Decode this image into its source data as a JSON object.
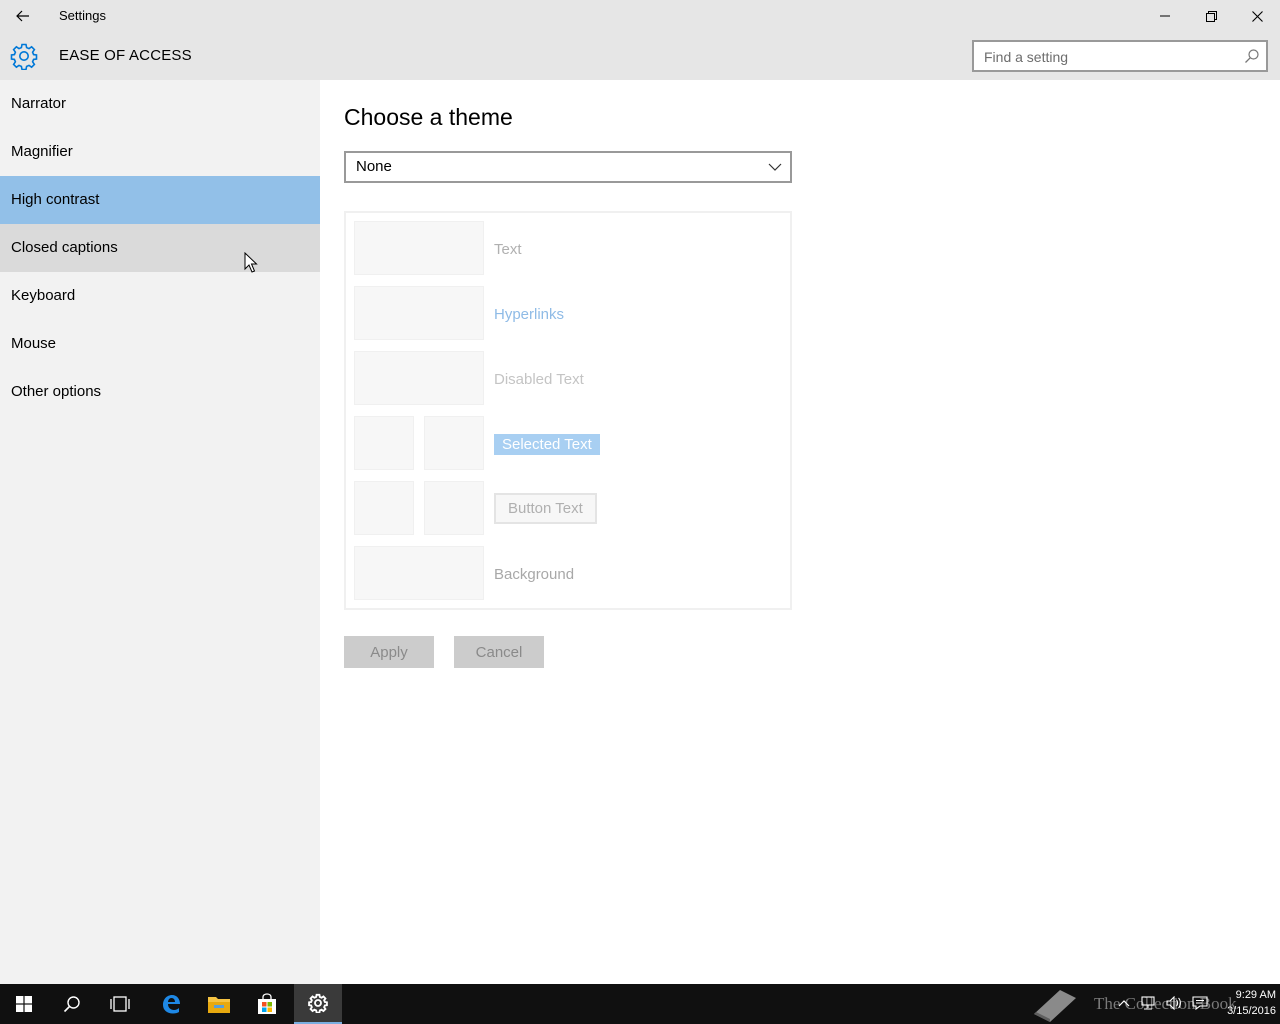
{
  "window": {
    "title": "Settings"
  },
  "header": {
    "section_title": "EASE OF ACCESS",
    "search_placeholder": "Find a setting"
  },
  "sidebar": {
    "items": [
      {
        "label": "Narrator",
        "state": "normal"
      },
      {
        "label": "Magnifier",
        "state": "normal"
      },
      {
        "label": "High contrast",
        "state": "selected"
      },
      {
        "label": "Closed captions",
        "state": "hover"
      },
      {
        "label": "Keyboard",
        "state": "normal"
      },
      {
        "label": "Mouse",
        "state": "normal"
      },
      {
        "label": "Other options",
        "state": "normal"
      }
    ]
  },
  "main": {
    "title": "Choose a theme",
    "theme_dropdown": {
      "selected": "None"
    },
    "preview": {
      "text": "Text",
      "hyperlinks": "Hyperlinks",
      "disabled_text": "Disabled Text",
      "selected_text": "Selected Text",
      "button_text": "Button Text",
      "background": "Background"
    },
    "apply_label": "Apply",
    "cancel_label": "Cancel"
  },
  "taskbar": {
    "watermark": "The Collection Book",
    "time": "9:29 AM",
    "date": "3/15/2016"
  },
  "colors": {
    "accent": "#0078d7",
    "selected_item": "#92c0e8",
    "sidebar_bg": "#f2f2f2",
    "header_bg": "#e6e6e6",
    "taskbar_bg": "#101010"
  }
}
